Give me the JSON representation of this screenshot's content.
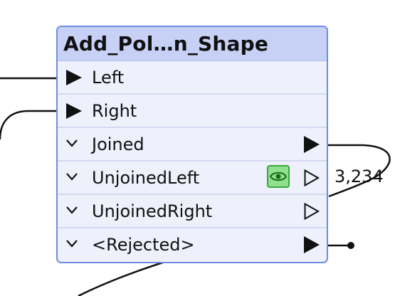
{
  "node": {
    "title": "Add_Pol…n_Shape",
    "inputs": [
      {
        "label": "Left",
        "icon": "input-port-arrow-icon"
      },
      {
        "label": "Right",
        "icon": "input-port-arrow-icon"
      }
    ],
    "outputs": [
      {
        "label": "Joined",
        "icon": "output-port-filled-icon",
        "connected": true
      },
      {
        "label": "UnjoinedLeft",
        "icon": "output-port-hollow-icon",
        "connected": false,
        "inspect": true,
        "feature_count": "3,234"
      },
      {
        "label": "UnjoinedRight",
        "icon": "output-port-hollow-icon",
        "connected": false
      },
      {
        "label": "<Rejected>",
        "icon": "output-port-filled-icon",
        "connected": true
      }
    ]
  },
  "colors": {
    "header_bg": "#c7d1f6",
    "body_bg": "#eef0fb",
    "border": "#6f8de0",
    "inspect_bg": "#8fe08f",
    "inspect_border": "#39a839",
    "connection": "#111111"
  }
}
